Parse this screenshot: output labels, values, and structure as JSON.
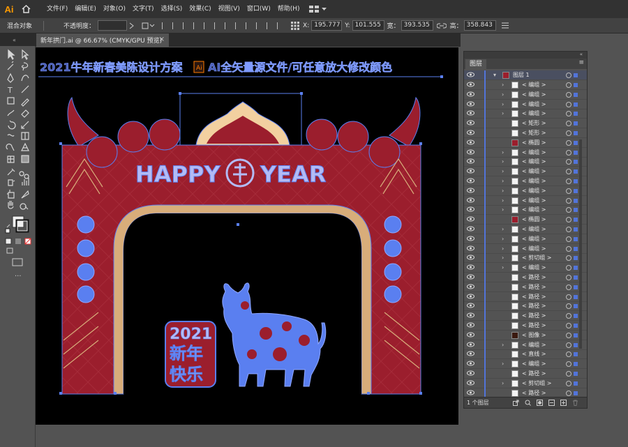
{
  "app": {
    "logo": "Ai",
    "home_icon": "home-icon"
  },
  "menu": [
    "文件(F)",
    "编辑(E)",
    "对象(O)",
    "文字(T)",
    "选择(S)",
    "效果(C)",
    "视图(V)",
    "窗口(W)",
    "帮助(H)"
  ],
  "control": {
    "mode": "混合对象",
    "opacity_label": "不透明度：",
    "x_label": "X:",
    "x_value": "195.777",
    "y_label": "Y:",
    "y_value": "101.555",
    "w_label": "宽：",
    "w_value": "393.535",
    "h_label": "高：",
    "h_value": "358.843"
  },
  "document": {
    "tab_title": "新年拱门.ai @ 66.67% (CMYK/GPU 预览)",
    "close": "×"
  },
  "artwork": {
    "header_text": "2021牛年新春美陈设计方案",
    "header_text2": "AI全矢量源文件/可任意放大修改颜色",
    "ai_badge": "Ai",
    "happy": "HAPPY",
    "year": "YEAR",
    "badge_year": "2021",
    "badge_line1": "新年",
    "badge_line2": "快乐",
    "colors": {
      "red": "#9b1e2d",
      "gold": "#d8ad7a",
      "blue": "#5a7ff0",
      "cream": "#f2d0a0"
    }
  },
  "layers": {
    "title": "图层",
    "menu_icon": "≡",
    "parent": "图层 1",
    "items": [
      "< 编组 >",
      "< 编组 >",
      "< 编组 >",
      "< 编组 >",
      "< 矩形 >",
      "< 矩形 >",
      "< 椭圆 >",
      "< 编组 >",
      "< 编组 >",
      "< 编组 >",
      "< 编组 >",
      "< 编组 >",
      "< 编组 >",
      "< 编组 >",
      "< 椭圆 >",
      "< 编组 >",
      "< 编组 >",
      "< 编组 >",
      "< 剪切组 >",
      "< 编组 >",
      "< 路径 >",
      "< 路径 >",
      "< 路径 >",
      "< 路径 >",
      "< 路径 >",
      "< 路径 >",
      "< 图像 >",
      "< 编组 >",
      "< 直线 >",
      "< 编组 >",
      "< 路径 >",
      "< 剪切组 >",
      "< 路径 >",
      "< 剪切组 >"
    ],
    "footer": "1 个图层"
  }
}
